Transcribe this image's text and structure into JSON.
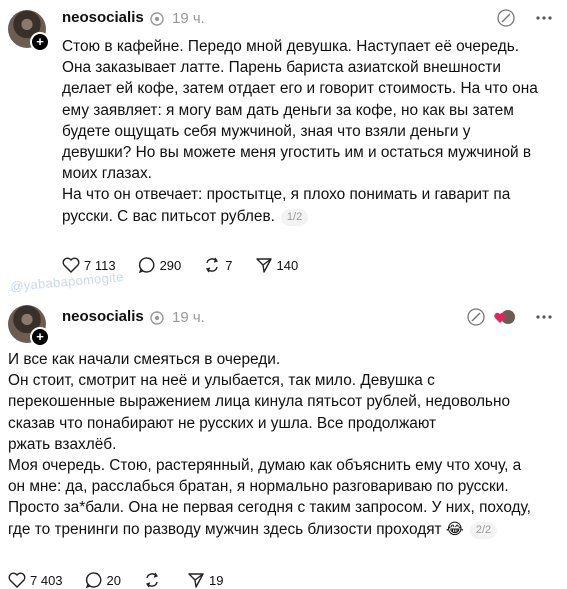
{
  "posts": [
    {
      "username": "neosocialis",
      "time": "19 ч.",
      "text": "Стою в кафейне. Передо мной девушка. Наступает её очередь.\nОна заказывает латте. Парень бариста азиатской внешности\nделает ей кофе, затем отдает его и говорит стоимость. На что она\nему заявляет: я могу вам дать деньги за кофе, но как вы затем\nбудете ощущать себя мужчиной, зная что взяли деньги у\nдевушки? Но вы можете меня угостить им и остаться мужчиной в\nмоих глазах.\nНа что он отвечает: простытце, я плохо понимать и гаварит па\nрусски. С вас питьсот рублев.",
      "page": "1/2",
      "likes": "7 113",
      "comments": "290",
      "reposts": "7",
      "shares": "140"
    },
    {
      "username": "neosocialis",
      "time": "19 ч.",
      "text": "И все как начали смеяться в очереди.\nОн стоит, смотрит на неё и улыбается, так мило. Девушка с\nперекошенные выражением лица кинула пятьсот рублей, недовольно\nсказав что понабирают не русских и ушла. Все продолжают\nржать взахлёб.\nМоя очередь. Стою, растерянный, думаю как объяснить ему что хочу, а\nон мне: да, расслабься братан, я нормально разговариваю по русски.\nПросто за*бали. Она не первая сегодня с таким запросом. У них, походу,\nгде то тренинги по разводу мужчин здесь близости проходят 😂",
      "page": "2/2",
      "likes": "7 403",
      "comments": "20",
      "reposts": "",
      "shares": "19"
    }
  ],
  "watermark": "@yababapomogite",
  "colors": {
    "text": "#101010",
    "muted": "#999999",
    "watermark": "#c9d9ea",
    "heart": "#e0245e"
  },
  "icons": [
    "avatar",
    "plus-icon",
    "verified-icon",
    "edit-icon",
    "more-icon",
    "heart-icon",
    "comment-icon",
    "repost-icon",
    "share-icon"
  ]
}
